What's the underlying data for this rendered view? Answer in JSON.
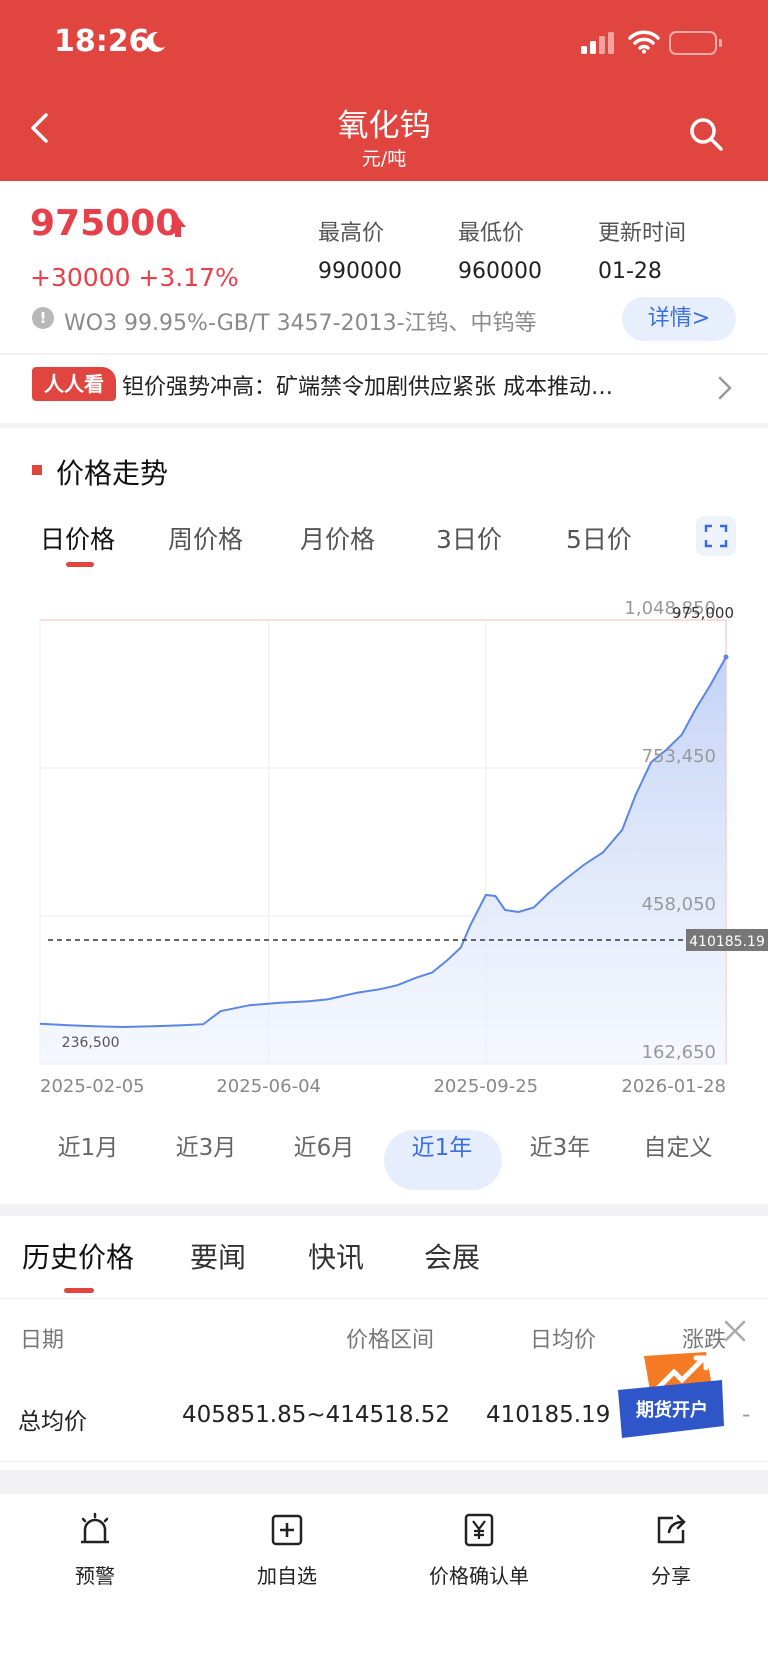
{
  "status_bar": {
    "time": "18:26"
  },
  "header": {
    "title": "氧化钨",
    "unit": "元/吨"
  },
  "price": {
    "current": "975000",
    "change": "+30000 +3.17%",
    "high_label": "最高价",
    "high": "990000",
    "low_label": "最低价",
    "low": "960000",
    "updated_label": "更新时间",
    "updated": "01-28",
    "spec": "WO3 99.95%-GB/T 3457-2013-江钨、中钨等",
    "detail_label": "详情>"
  },
  "news": {
    "tag": "人人看",
    "headline": "钽价强势冲高：矿端禁令加剧供应紧张 成本推动…"
  },
  "trend": {
    "section_title": "价格走势",
    "period_tabs": [
      "日价格",
      "周价格",
      "月价格",
      "3日价",
      "5日价"
    ],
    "active_period": "日价格",
    "range_tabs": [
      "近1月",
      "近3月",
      "近6月",
      "近1年",
      "近3年",
      "自定义"
    ],
    "active_range": "近1年"
  },
  "chart_data": {
    "type": "area",
    "x_ticks": [
      "2025-02-05",
      "2025-06-04",
      "2025-09-25",
      "2026-01-28"
    ],
    "y_ticks": [
      "1,048,850",
      "753,450",
      "458,050",
      "162,650"
    ],
    "ylim": [
      162650,
      1048850
    ],
    "x_domain": [
      "2025-02-05",
      "2026-01-28"
    ],
    "min_label": "236,500",
    "latest_label": "975,000",
    "average_line": 410185.19,
    "average_label": "410185.19",
    "grid": true,
    "x": [
      "2025-02-05",
      "2025-02-20",
      "2025-03-05",
      "2025-03-20",
      "2025-04-05",
      "2025-04-20",
      "2025-05-01",
      "2025-05-10",
      "2025-05-25",
      "2025-06-10",
      "2025-06-25",
      "2025-07-05",
      "2025-07-20",
      "2025-08-01",
      "2025-08-10",
      "2025-08-20",
      "2025-08-28",
      "2025-09-05",
      "2025-09-12",
      "2025-09-17",
      "2025-09-25",
      "2025-09-30",
      "2025-10-05",
      "2025-10-12",
      "2025-10-20",
      "2025-10-28",
      "2025-11-05",
      "2025-11-15",
      "2025-11-25",
      "2025-12-05",
      "2025-12-12",
      "2025-12-20",
      "2025-12-28",
      "2026-01-05",
      "2026-01-12",
      "2026-01-20",
      "2026-01-28"
    ],
    "y": [
      243000,
      240000,
      238000,
      236500,
      238000,
      240000,
      242000,
      268000,
      280000,
      285000,
      288000,
      292000,
      305000,
      312000,
      320000,
      335000,
      345000,
      370000,
      395000,
      440000,
      500000,
      498000,
      470000,
      466000,
      475000,
      505000,
      530000,
      560000,
      585000,
      630000,
      700000,
      765000,
      790000,
      820000,
      870000,
      920000,
      975000
    ]
  },
  "history": {
    "tabs": [
      "历史价格",
      "要闻",
      "快讯",
      "会展"
    ],
    "active_tab": "历史价格",
    "columns": [
      "日期",
      "价格区间",
      "日均价",
      "涨跌"
    ],
    "row": {
      "date": "总均价",
      "range": "405851.85~414518.52",
      "avg": "410185.19",
      "change": "-"
    },
    "promo_label": "期货开户"
  },
  "bottom_bar": [
    "预警",
    "加自选",
    "价格确认单",
    "分享"
  ],
  "colors": {
    "brand_red": "#e0463f",
    "price_red": "#e8404a",
    "accent_blue": "#3b6fe0",
    "line_blue": "#5b86e5"
  }
}
